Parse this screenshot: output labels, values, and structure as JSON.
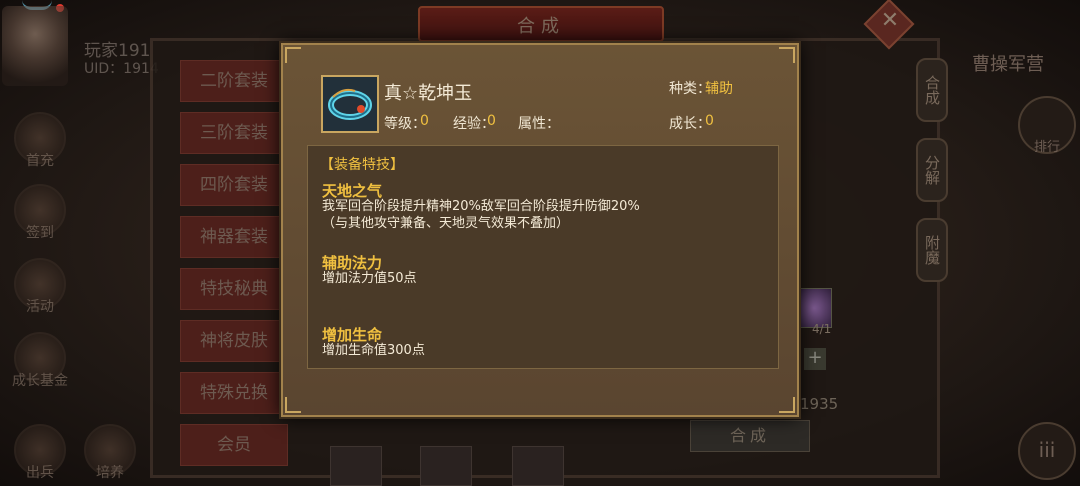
{
  "background": {
    "title": "合成",
    "player_name": "玩家191",
    "player_uid": "UID：1914",
    "left_icons": [
      "首充",
      "签到",
      "活动",
      "成长基金"
    ],
    "bottom_left": [
      "出兵",
      "培养"
    ],
    "menu_items": [
      "二阶套装",
      "三阶套装",
      "四阶套装",
      "神器套装",
      "特技秘典",
      "神将皮肤",
      "特殊兑换",
      "会员"
    ],
    "right_tabs": [
      "合成",
      "分解",
      "附魔"
    ],
    "camp_title": "曹操军营",
    "rank_label": "排行",
    "menu_glyph": "iii",
    "slot_count": "4/1",
    "plus": "+",
    "number": "1935",
    "compose_button": "合成",
    "close_glyph": "✕"
  },
  "item": {
    "name": "真☆乾坤玉",
    "kind_label": "种类：",
    "kind_value": "辅助",
    "level_label": "等级：",
    "level_value": "0",
    "exp_label": "经验：",
    "exp_value": "0",
    "attr_label": "属性：",
    "growth_label": "成长：",
    "growth_value": "0",
    "icon": "jade-ring-icon"
  },
  "skills": {
    "header": "【装备特技】",
    "list": [
      {
        "title": "天地之气",
        "desc": "我军回合阶段提升精神20%敌军回合阶段提升防御20%（与其他攻守兼备、天地灵气效果不叠加）"
      },
      {
        "title": "辅助法力",
        "desc": "增加法力值50点"
      },
      {
        "title": "增加生命",
        "desc": "增加生命值300点"
      }
    ]
  },
  "colors": {
    "gold": "#f0c040",
    "panel": "#5a4530",
    "frame": "#a2824c"
  }
}
